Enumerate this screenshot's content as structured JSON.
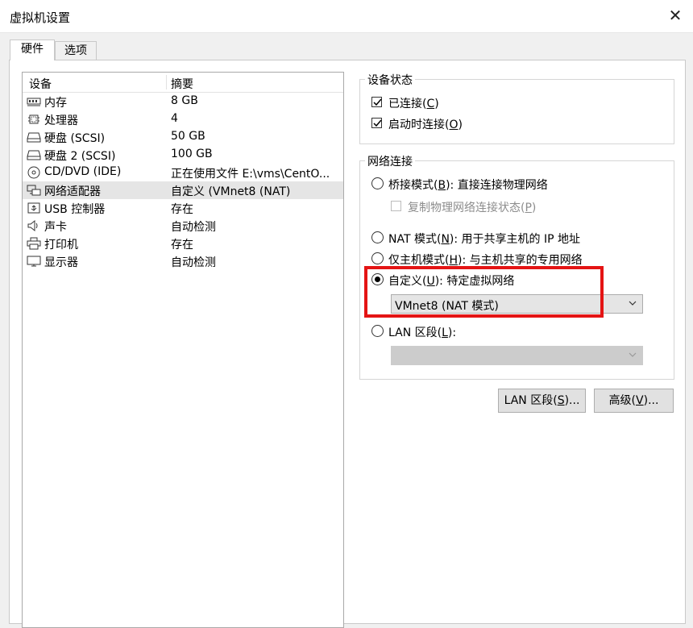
{
  "window": {
    "title": "虚拟机设置",
    "close_icon": "close-icon"
  },
  "tabs": [
    {
      "label": "硬件",
      "active": true
    },
    {
      "label": "选项",
      "active": false
    }
  ],
  "device_list": {
    "headers": {
      "device": "设备",
      "summary": "摘要"
    },
    "rows": [
      {
        "icon": "memory-icon",
        "name": "内存",
        "summary": "8 GB"
      },
      {
        "icon": "processor-icon",
        "name": "处理器",
        "summary": "4"
      },
      {
        "icon": "harddisk-icon",
        "name": "硬盘 (SCSI)",
        "summary": "50 GB"
      },
      {
        "icon": "harddisk-icon",
        "name": "硬盘 2 (SCSI)",
        "summary": "100 GB"
      },
      {
        "icon": "cd-dvd-icon",
        "name": "CD/DVD (IDE)",
        "summary": "正在使用文件 E:\\vms\\CentO..."
      },
      {
        "icon": "network-adapter-icon",
        "name": "网络适配器",
        "summary": "自定义 (VMnet8 (NAT)",
        "selected": true
      },
      {
        "icon": "usb-icon",
        "name": "USB 控制器",
        "summary": "存在"
      },
      {
        "icon": "speaker-icon",
        "name": "声卡",
        "summary": "自动检测"
      },
      {
        "icon": "printer-icon",
        "name": "打印机",
        "summary": "存在"
      },
      {
        "icon": "display-icon",
        "name": "显示器",
        "summary": "自动检测"
      }
    ]
  },
  "device_status": {
    "title": "设备状态",
    "connected": {
      "text": "已连接(",
      "key": "C",
      "end": ")",
      "checked": true
    },
    "connect_at_power_on": {
      "text": "启动时连接(",
      "key": "O",
      "end": ")",
      "checked": true
    }
  },
  "network_connection": {
    "title": "网络连接",
    "bridged": {
      "text": "桥接模式(",
      "key": "B",
      "end": "): 直接连接物理网络"
    },
    "replicate": {
      "text": "复制物理网络连接状态(",
      "key": "P",
      "end": ")"
    },
    "nat": {
      "text": "NAT 模式(",
      "key": "N",
      "end": "): 用于共享主机的 IP 地址"
    },
    "host_only": {
      "text": "仅主机模式(",
      "key": "H",
      "end": "): 与主机共享的专用网络"
    },
    "custom": {
      "text": "自定义(",
      "key": "U",
      "end": "): 特定虚拟网络",
      "selected": true
    },
    "custom_select_value": "VMnet8 (NAT 模式)",
    "lan_segment": {
      "text": "LAN 区段(",
      "key": "L",
      "end": "):"
    },
    "lan_select_value": ""
  },
  "buttons": {
    "lan_segments": {
      "text": "LAN 区段(",
      "key": "S",
      "end": ")..."
    },
    "advanced": {
      "text": "高级(",
      "key": "V",
      "end": ")..."
    }
  },
  "colors": {
    "highlight": "#e41414",
    "selected_row": "#e5e5e5"
  }
}
